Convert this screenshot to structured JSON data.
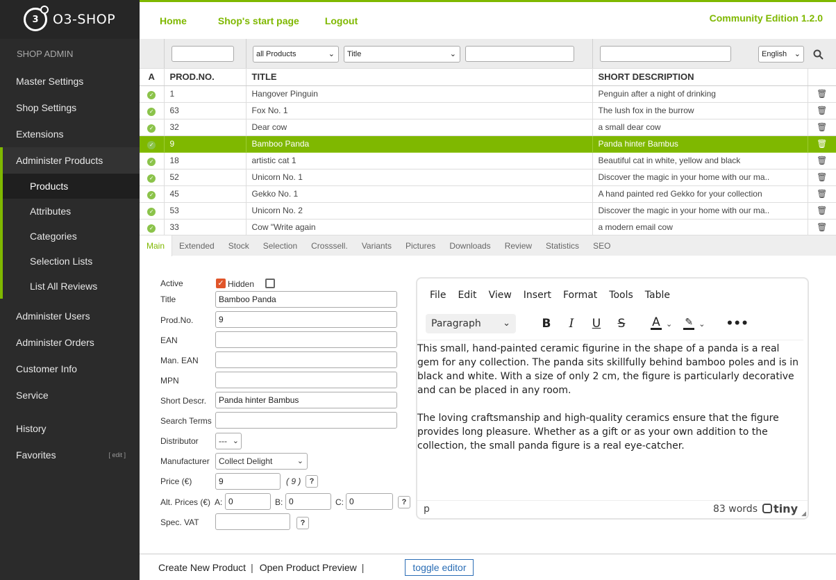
{
  "brand": {
    "logo_mark": "3",
    "name": "O3-SHOP"
  },
  "sidebar": {
    "header": "SHOP ADMIN",
    "items_top": [
      "Master Settings",
      "Shop Settings",
      "Extensions"
    ],
    "group_label": "Administer Products",
    "sub_items": [
      "Products",
      "Attributes",
      "Categories",
      "Selection Lists",
      "List All Reviews"
    ],
    "items_bottom": [
      "Administer Users",
      "Administer Orders",
      "Customer Info",
      "Service"
    ],
    "history": "History",
    "favorites": "Favorites",
    "favorites_edit": "[ edit ]"
  },
  "topbar": {
    "links": [
      "Home",
      "Shop's start page",
      "Logout"
    ],
    "edition": "Community Edition 1.2.0"
  },
  "filters": {
    "list_select": "all Products",
    "field_select": "Title",
    "language": "English"
  },
  "table": {
    "headers": [
      "A",
      "PROD.NO.",
      "TITLE",
      "SHORT DESCRIPTION"
    ],
    "rows": [
      {
        "no": "1",
        "title": "Hangover Pinguin",
        "desc": "Penguin after a night of drinking"
      },
      {
        "no": "63",
        "title": "Fox No. 1",
        "desc": "The lush fox in the burrow"
      },
      {
        "no": "32",
        "title": "Dear cow",
        "desc": "a small dear cow"
      },
      {
        "no": "9",
        "title": "Bamboo Panda",
        "desc": "Panda hinter Bambus"
      },
      {
        "no": "18",
        "title": "artistic cat 1",
        "desc": "Beautiful cat in white, yellow and black"
      },
      {
        "no": "52",
        "title": "Unicorn No. 1",
        "desc": "Discover the magic in your home with our ma.."
      },
      {
        "no": "45",
        "title": "Gekko No. 1",
        "desc": "A hand painted red Gekko for your collection"
      },
      {
        "no": "53",
        "title": "Unicorn No. 2",
        "desc": "Discover the magic in your home with our ma.."
      },
      {
        "no": "33",
        "title": "Cow \"Write again",
        "desc": "a modern email cow"
      }
    ],
    "selected_index": 3
  },
  "tabs": [
    "Main",
    "Extended",
    "Stock",
    "Selection",
    "Crosssell.",
    "Variants",
    "Pictures",
    "Downloads",
    "Review",
    "Statistics",
    "SEO"
  ],
  "form": {
    "active_label": "Active",
    "hidden_label": "Hidden",
    "title_label": "Title",
    "title_value": "Bamboo Panda",
    "prodno_label": "Prod.No.",
    "prodno_value": "9",
    "ean_label": "EAN",
    "man_ean_label": "Man. EAN",
    "mpn_label": "MPN",
    "short_desc_label": "Short Descr.",
    "short_desc_value": "Panda hinter Bambus",
    "search_terms_label": "Search Terms",
    "distributor_label": "Distributor",
    "distributor_value": "---",
    "manufacturer_label": "Manufacturer",
    "manufacturer_value": "Collect Delight",
    "price_label": "Price (€)",
    "price_value": "9",
    "price_hint": "( 9 )",
    "alt_prices_label": "Alt. Prices (€)",
    "alt_a_label": "A:",
    "alt_a_value": "0",
    "alt_b_label": "B:",
    "alt_b_value": "0",
    "alt_c_label": "C:",
    "alt_c_value": "0",
    "vat_label": "Spec. VAT",
    "help_mark": "?"
  },
  "editor": {
    "menu": [
      "File",
      "Edit",
      "View",
      "Insert",
      "Format",
      "Tools",
      "Table"
    ],
    "block_format": "Paragraph",
    "paragraph1": "This small, hand-painted ceramic figurine in the shape of a panda is a real gem for any collection. The panda sits skillfully behind bamboo poles and is in black and white. With a size of only 2 cm, the figure is particularly decorative and can be placed in any room.",
    "paragraph2": "The loving craftsmanship and high-quality ceramics ensure that the figure provides long pleasure. Whether as a gift or as your own addition to the collection, the small panda figure is a real eye-catcher.",
    "path": "p",
    "word_count": "83 words",
    "brand": "tiny"
  },
  "bottombar": {
    "create": "Create New Product",
    "preview": "Open Product Preview",
    "separator": "|",
    "toggle": "toggle editor"
  },
  "colors": {
    "accent": "#7fb800",
    "sidebar": "#2b2b2b",
    "checkbox_on": "#e0552a"
  }
}
